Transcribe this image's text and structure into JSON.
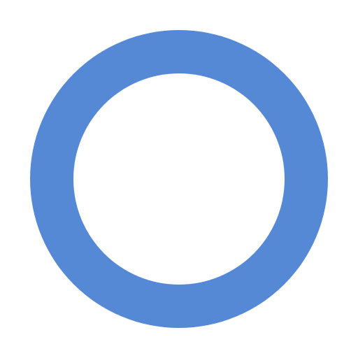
{
  "icon": {
    "name": "circle-outline-icon",
    "ring_color": "#5589D5",
    "fill_color": "#FFFFFF",
    "background_color": "#FFFFFF"
  }
}
